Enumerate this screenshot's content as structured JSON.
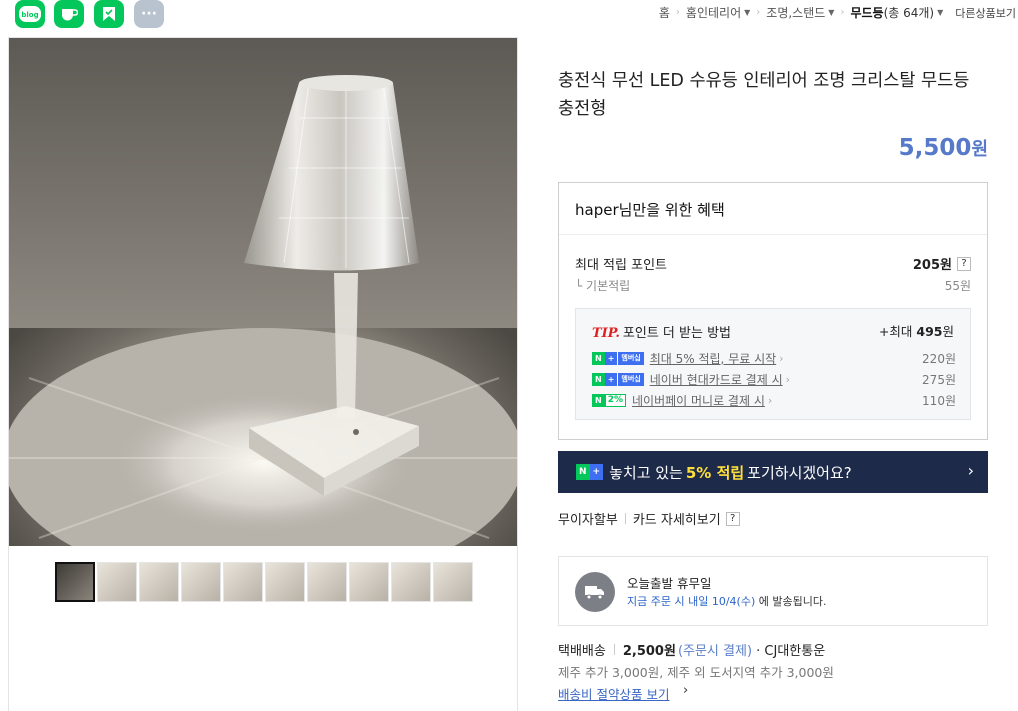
{
  "share": {
    "blog_label": "blog",
    "more_label": "···"
  },
  "breadcrumb": {
    "items": [
      "홈",
      "홈인테리어",
      "조명,스탠드"
    ],
    "current": "무드등",
    "count": "(총 64개)",
    "more": "다른상품보기"
  },
  "gallery": {
    "thumbnail_count": 10
  },
  "product": {
    "title": "충전식 무선 LED 수유등 인테리어 조명 크리스탈 무드등 충전형",
    "price": "5,500",
    "price_unit": "원"
  },
  "benefit": {
    "heading_user": "haper",
    "heading_rest": "님만을 위한 혜택",
    "max_points_label": "최대 적립 포인트",
    "max_points_value": "205원",
    "help": "?",
    "base_label": "기본적립",
    "base_value": "55원",
    "tip": {
      "tip_word": "TIP.",
      "title": "포인트 더 받는 방법",
      "max_prefix": "+최대",
      "max_value": "495",
      "max_unit": "원",
      "rows": [
        {
          "badge_n": "N",
          "badge_p": "+",
          "badge_m": "멤버십",
          "text": "최대 5% 적립, 무료 시작",
          "value": "220원"
        },
        {
          "badge_n": "N",
          "badge_p": "+",
          "badge_m": "멤버십",
          "text": "네이버 현대카드로 결제 시",
          "value": "275원"
        },
        {
          "badge_n": "N",
          "badge_2": "2%",
          "text": "네이버페이 머니로 결제 시",
          "value": "110원"
        }
      ]
    }
  },
  "banner": {
    "n": "N",
    "plus": "+",
    "text_before": "놓치고 있는",
    "highlight": "5% 적립",
    "text_after": "포기하시겠어요?",
    "arrow": "›"
  },
  "card_info": {
    "installment": "무이자할부",
    "card_detail": "카드 자세히보기",
    "help": "?"
  },
  "shipping_notice": {
    "title": "오늘출발 휴무일",
    "sub_blue": "지금 주문 시 내일 10/4(수)",
    "sub_rest": " 에 발송됩니다."
  },
  "delivery": {
    "method": "택배배송",
    "fee": "2,500원",
    "fee_note": "(주문시 결제)",
    "carrier": "· CJ대한통운",
    "extra": "제주 추가 3,000원, 제주 외 도서지역 추가 3,000원",
    "save_link": "배송비 절약상품 보기",
    "save_arrow": "›"
  },
  "colors": {
    "naver_green": "#03c75a",
    "price_blue": "#5679c9",
    "banner_navy": "#1e2a4a",
    "highlight_yellow": "#ffe03a"
  }
}
